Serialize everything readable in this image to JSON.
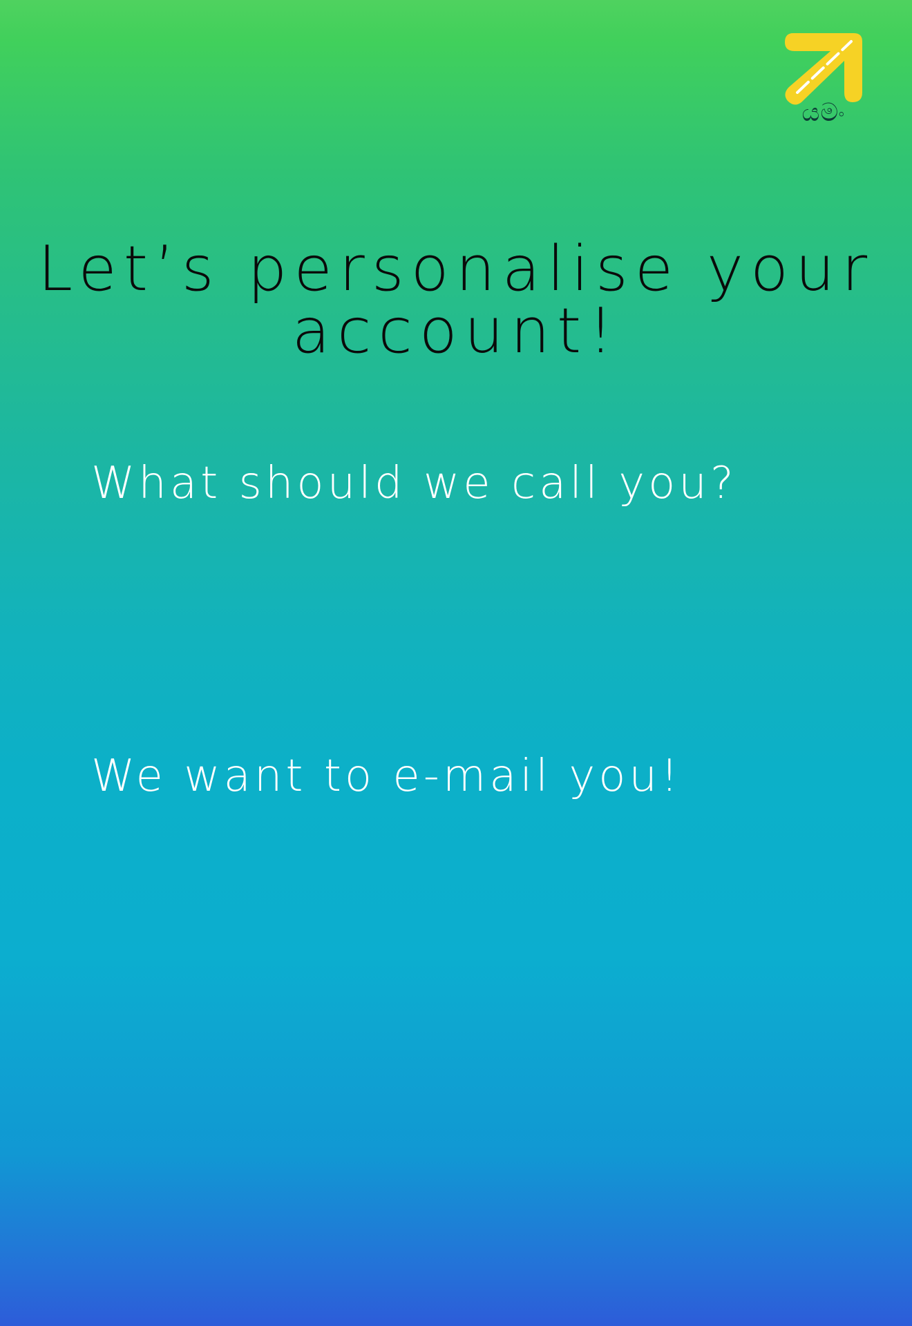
{
  "brand": {
    "logo_text": "යමං",
    "icon": "arrow-up-right-icon",
    "accent_color": "#f6d225"
  },
  "page": {
    "title": "Let’s personalise your account!"
  },
  "form": {
    "name": {
      "label": "What should we call you?",
      "value": ""
    },
    "email": {
      "label": "We want to e-mail you!",
      "value": ""
    }
  }
}
